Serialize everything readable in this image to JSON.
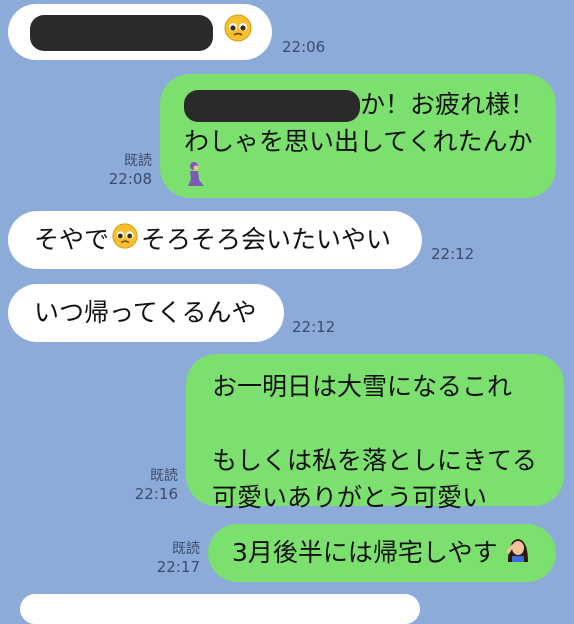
{
  "messages": [
    {
      "side": "in",
      "text": "",
      "time": "22:06"
    },
    {
      "side": "out",
      "line1_suffix": "か！お疲れ様！",
      "line2": "わしゃを思い出してくれたんか",
      "read": "既読",
      "time": "22:08"
    },
    {
      "side": "in",
      "text_before": "そやで",
      "text_after": "そろそろ会いたいやい",
      "time": "22:12"
    },
    {
      "side": "in",
      "text": "いつ帰ってくるんや",
      "time": "22:12"
    },
    {
      "side": "out",
      "lines": [
        "お一明日は大雪になるこれ",
        "",
        "もしくは私を落としにきてる",
        "可愛いありがとう可愛い"
      ],
      "read": "既読",
      "time": "22:16"
    },
    {
      "side": "out",
      "text": "3月後半には帰宅しやす",
      "read": "既読",
      "time": "22:17"
    }
  ],
  "colors": {
    "background": "#8CABD9",
    "incoming_bubble": "#FFFFFF",
    "outgoing_bubble": "#7BE06E",
    "meta_text": "#3C4C6C"
  },
  "icons": [
    "pleading-face-emoji",
    "person-kneeling-emoji",
    "woman-gesture-emoji",
    "redaction-bar"
  ]
}
